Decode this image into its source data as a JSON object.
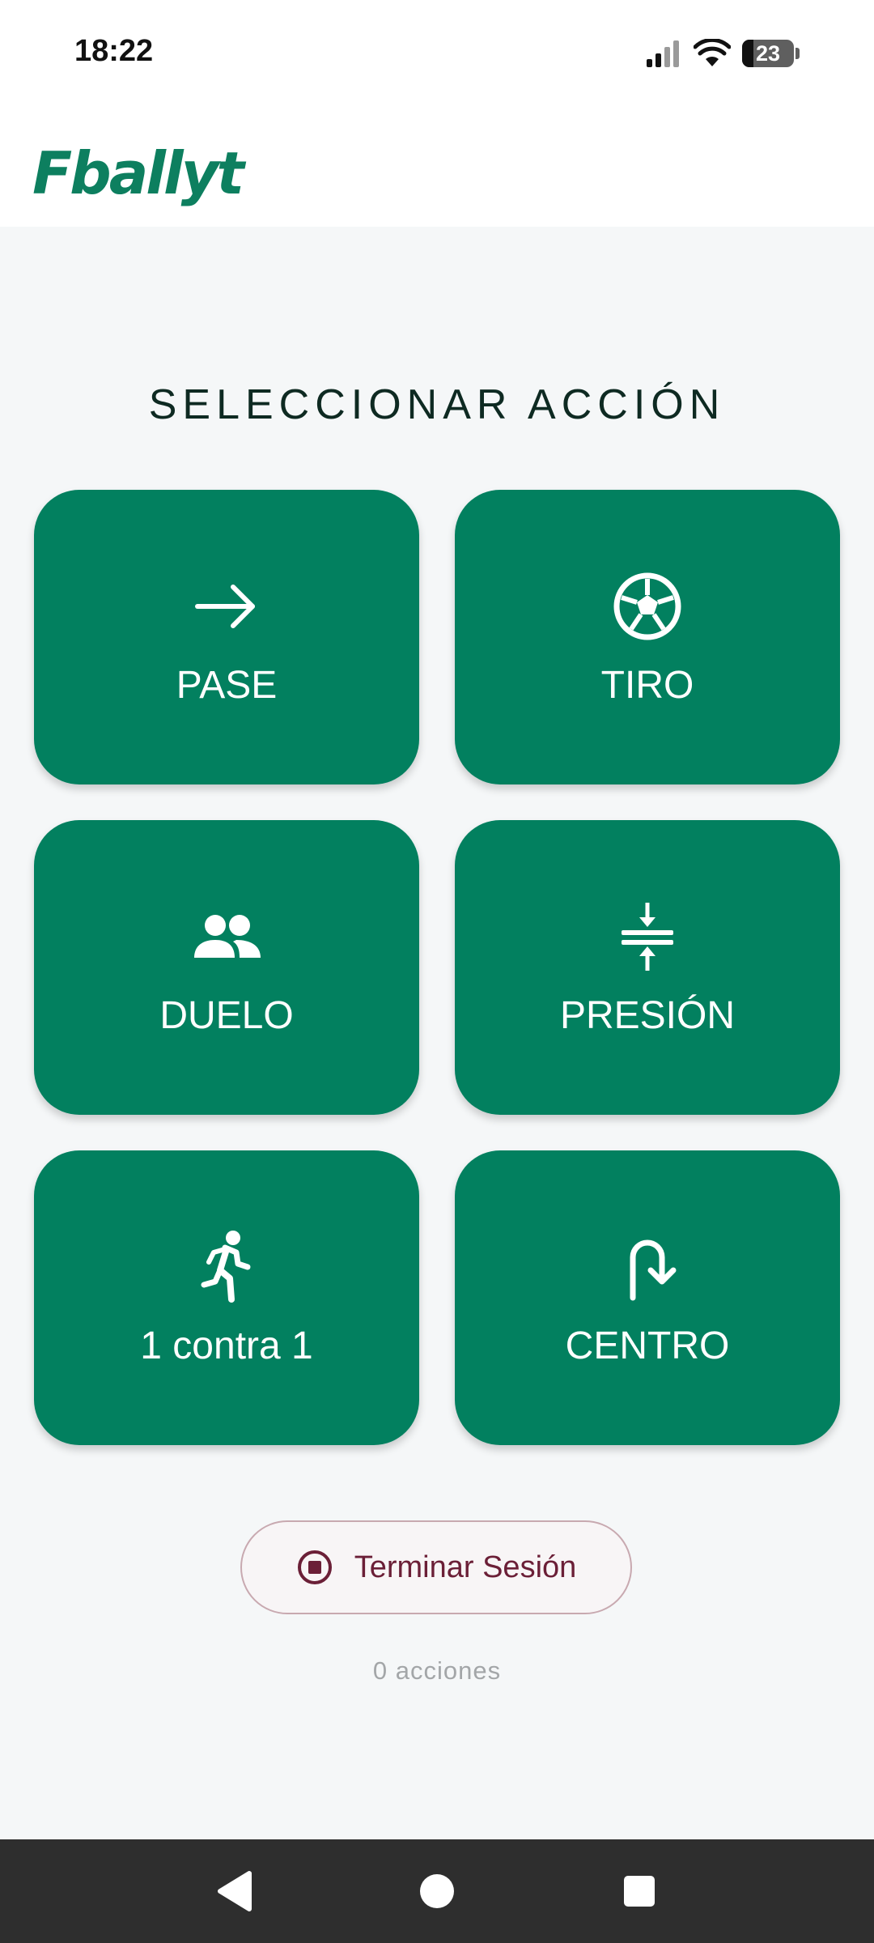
{
  "status_bar": {
    "time": "18:22",
    "battery_level": "23",
    "icons": [
      "signal-icon",
      "wifi-icon",
      "battery-icon"
    ]
  },
  "app_bar": {
    "logo_text": "Fballyt"
  },
  "main": {
    "title": "SELECCIONAR ACCIÓN",
    "actions": [
      {
        "label": "PASE",
        "icon": "arrow-right-icon"
      },
      {
        "label": "TIRO",
        "icon": "soccer-ball-icon"
      },
      {
        "label": "DUELO",
        "icon": "people-icon"
      },
      {
        "label": "PRESIÓN",
        "icon": "compress-icon"
      },
      {
        "label": "1 contra 1",
        "icon": "running-icon"
      },
      {
        "label": "CENTRO",
        "icon": "curved-arrow-icon"
      }
    ],
    "end_session_label": "Terminar Sesión",
    "actions_count": "0 acciones"
  },
  "colors": {
    "primary": "#02805F",
    "background": "#F5F7F8",
    "end_session": "#6B1F37",
    "nav_bar": "#2E2E2E"
  },
  "nav_bar": {
    "buttons": [
      "back-icon",
      "home-icon",
      "recents-icon"
    ]
  }
}
